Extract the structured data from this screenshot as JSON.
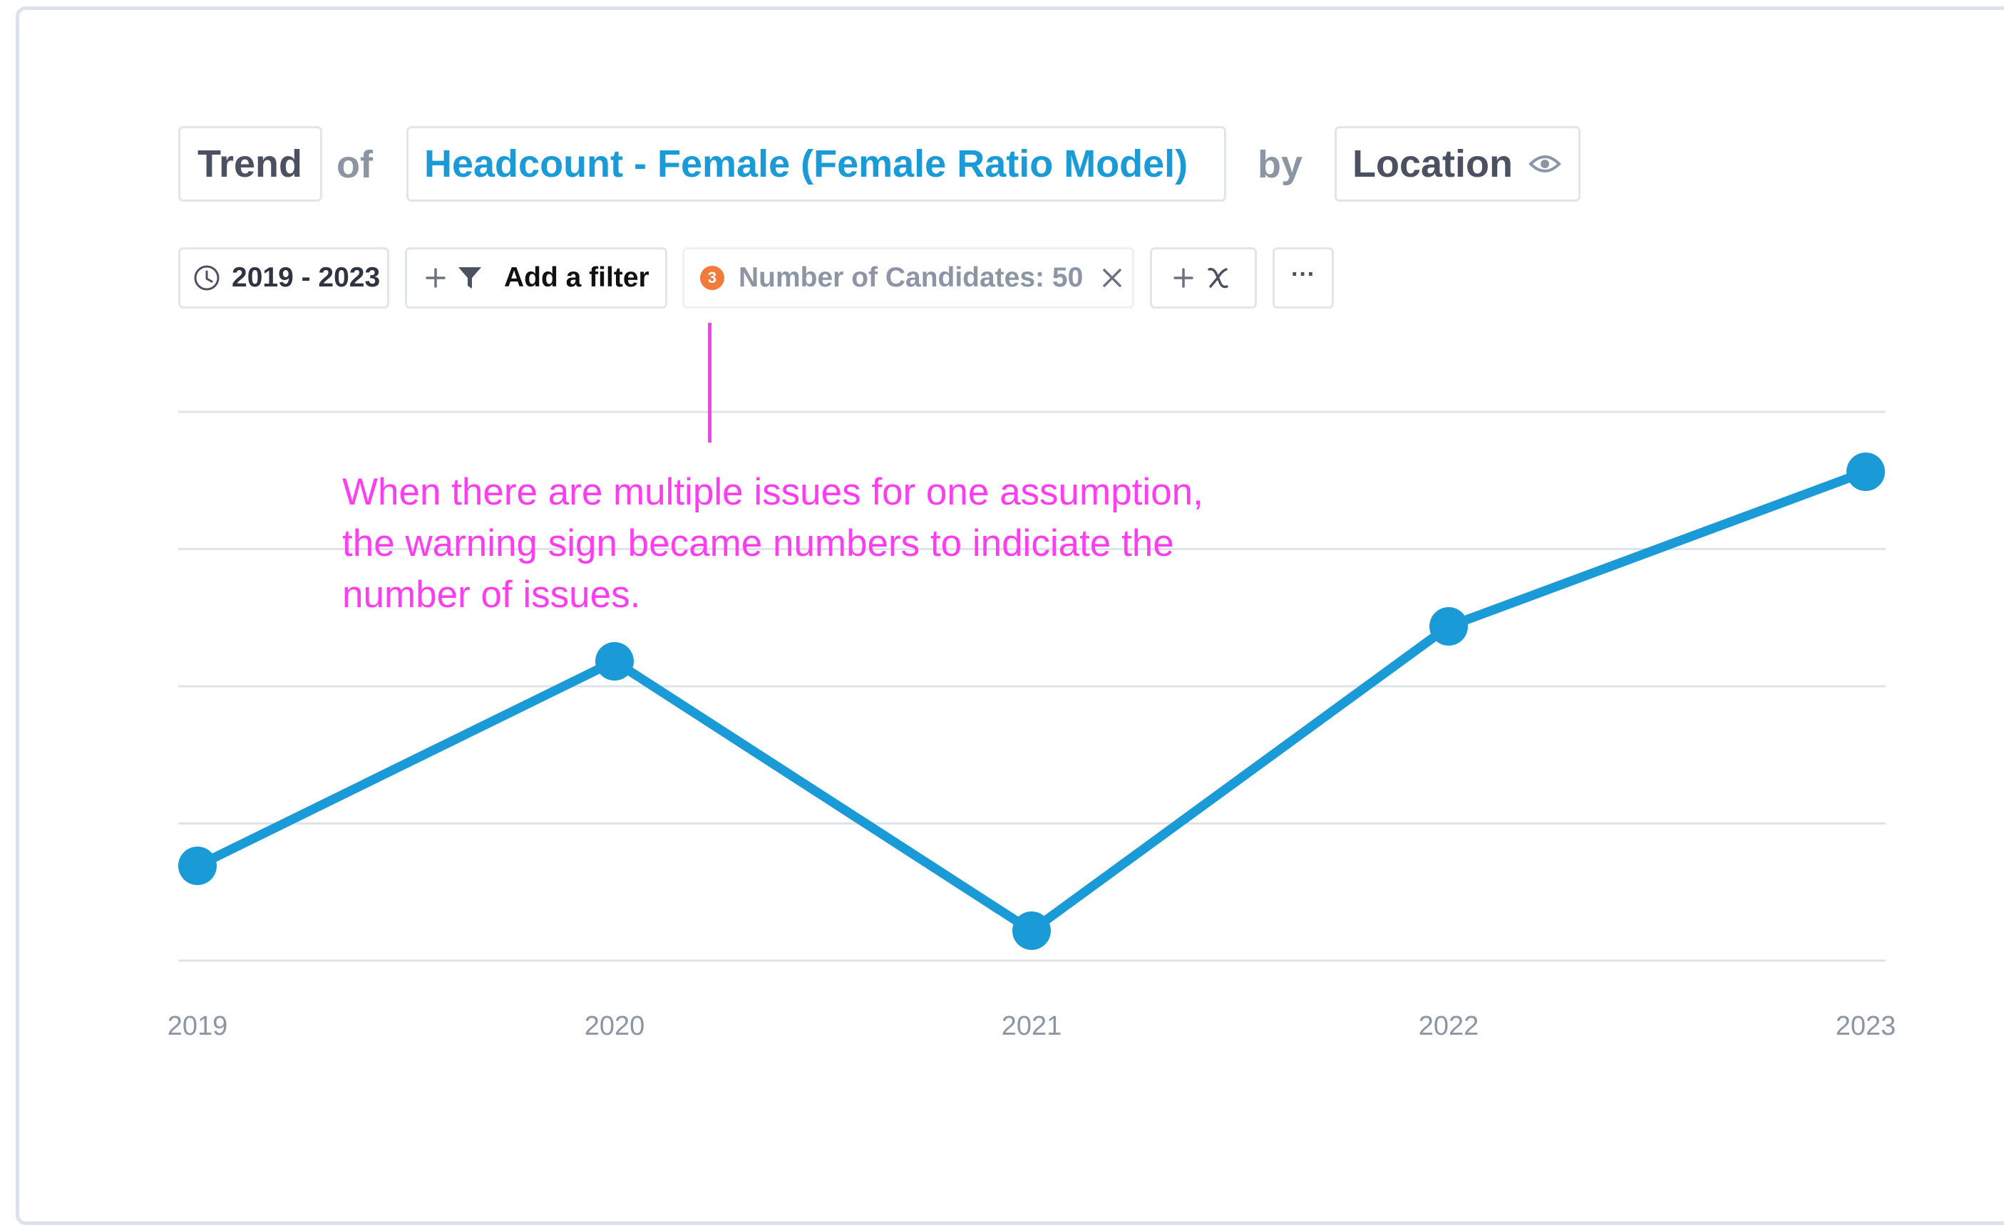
{
  "query": {
    "mode_label": "Trend",
    "of_word": "of",
    "metric_label": "Headcount - Female (Female Ratio Model)",
    "by_word": "by",
    "dimension_label": "Location"
  },
  "toolbar": {
    "date_range": "2019 - 2023",
    "add_filter_label": "Add a filter",
    "filter_tag": {
      "issue_count": "3",
      "label": "Number of Candidates: 50"
    },
    "more_label": "···"
  },
  "annotation": {
    "text": "When there are multiple issues for one assumption, the warning sign became numbers to indiciate the number of issues."
  },
  "colors": {
    "accent": "#1a9ad6",
    "warning": "#f07b3a",
    "annotation": "#ff3df0"
  },
  "chart_data": {
    "type": "line",
    "categories": [
      "2019",
      "2020",
      "2021",
      "2022",
      "2023"
    ],
    "values": [
      0.19,
      0.6,
      0.06,
      0.67,
      0.98
    ],
    "ylim": [
      0,
      1.1
    ],
    "grid": true,
    "y_ticks_shown": false,
    "title": "",
    "xlabel": "",
    "ylabel": ""
  }
}
